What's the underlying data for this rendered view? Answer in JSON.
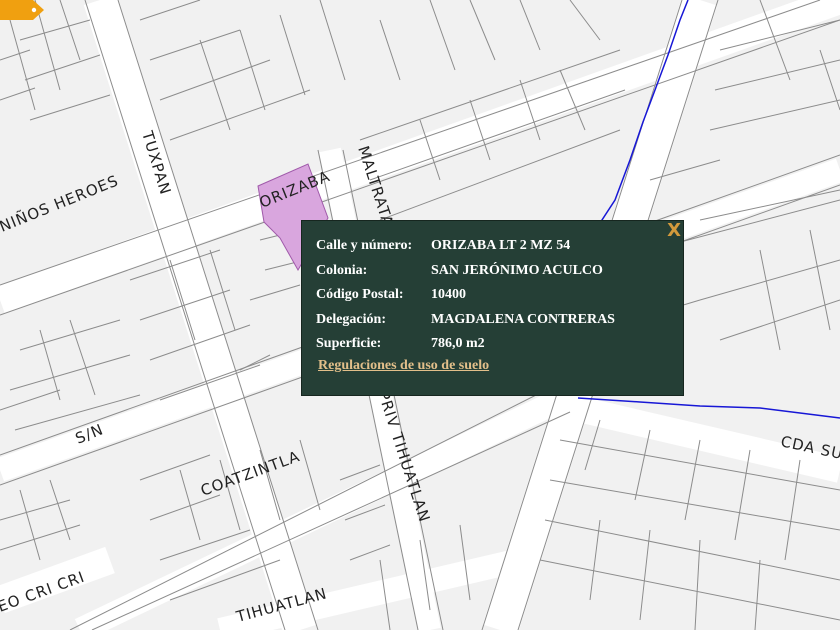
{
  "map": {
    "streets": {
      "orizaba": "ORIZABA",
      "maltrata": "MALTRATA",
      "tuxpan": "TUXPAN",
      "ninos_heroes": "NIÑOS HEROES",
      "sn": "S/N",
      "coatzintla": "COATZINTLA",
      "priv_tihuatlan": "PRIV TIHUATLAN",
      "tihuatlan": "TIHUATLAN",
      "poza_rica": "EO CRI CRI",
      "cda_su": "CDA SU"
    },
    "colors": {
      "background": "#f1f1f1",
      "parcel_line": "#8c8c8c",
      "selected_parcel": "#d9a6de",
      "boundary": "#1717d6",
      "popup_bg": "#253f36",
      "marker": "#f0a010"
    }
  },
  "popup": {
    "close_label": "X",
    "rows": [
      {
        "label": "Calle y número:",
        "value": "ORIZABA LT 2 MZ 54"
      },
      {
        "label": "Colonia:",
        "value": "SAN JERÓNIMO ACULCO"
      },
      {
        "label": "Código Postal:",
        "value": "10400"
      },
      {
        "label": "Delegación:",
        "value": "MAGDALENA CONTRERAS"
      },
      {
        "label": "Superficie:",
        "value": "786,0 m2"
      }
    ],
    "link_label": "Regulaciones de uso de suelo"
  }
}
